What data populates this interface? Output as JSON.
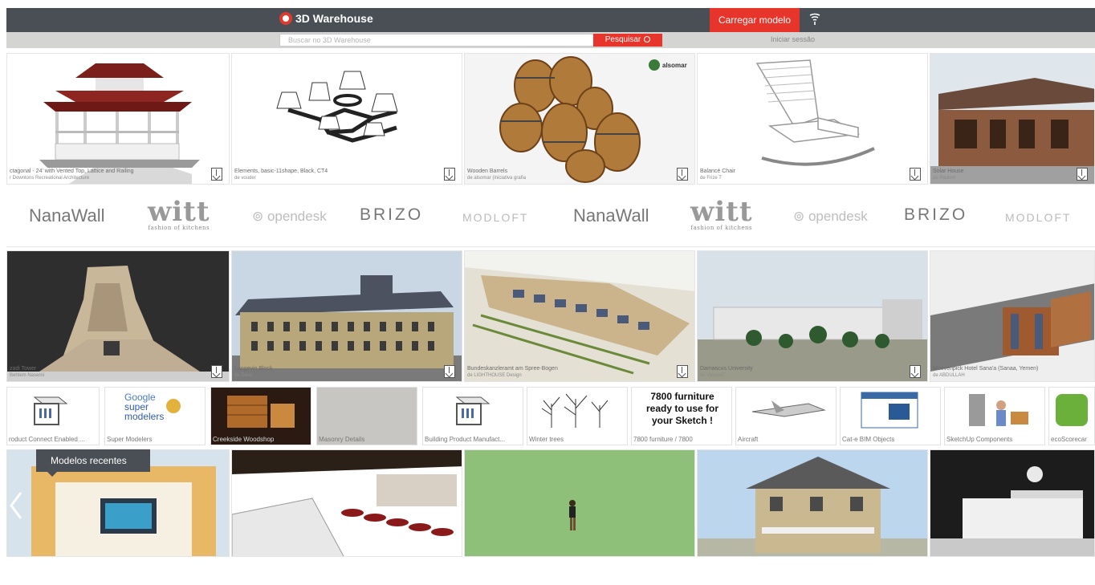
{
  "header": {
    "brand": "3D Warehouse",
    "upload_label": "Carregar modelo",
    "brand_icon": "3d-warehouse-logo-icon",
    "menu_icon": "wifi-icon"
  },
  "search": {
    "placeholder": "Buscar no 3D Warehouse",
    "button_label": "Pesquisar",
    "login_label": "Iniciar sessão"
  },
  "row1": [
    {
      "title": "ctagonal - 24' with Vented Top, Lattice and Railing",
      "author": "r Downtons Recreational Architecture"
    },
    {
      "title": "Elements, basic-11shape, Black, CT4",
      "author": "de vouder"
    },
    {
      "title": "Wooden Barrels",
      "author": "de alsomar (iniciativa grafia"
    },
    {
      "title": "Balancé Chair",
      "author": "de Frize T"
    },
    {
      "title": "Solar House",
      "author": "de Paulvel"
    }
  ],
  "row1_badge": "alsomar",
  "partners": [
    "NanaWall",
    "witt",
    "opendesk",
    "BRIZO",
    "MODLOFT",
    "NanaWall",
    "witt",
    "opendesk",
    "BRIZO",
    "MODLOFT"
  ],
  "witt_sub": "fashion of kitchens",
  "row2": [
    {
      "title": "zadi Tower",
      "author": "Behtem Naserni"
    },
    {
      "title": "Langevin Block",
      "author": "de Dave"
    },
    {
      "title": "Bundeskanzleramt am Spree-Bogen",
      "author": "de LIGHTHOUSE Design"
    },
    {
      "title": "Damascus University",
      "author": "de Venus87"
    },
    {
      "title": "Moevenpick Hotel Sana'a (Sanaa, Yemen)",
      "author": "de ABDULLAH"
    }
  ],
  "collections": [
    {
      "label": "roduct Connect Enabled ..."
    },
    {
      "label": "Super Modelers"
    },
    {
      "label": "Creekside Woodshop"
    },
    {
      "label": "Masonry Details"
    },
    {
      "label": "Building Product Manufact..."
    },
    {
      "label": "Winter trees"
    },
    {
      "label": "7800 furniture / 7800"
    },
    {
      "label": "Aircraft"
    },
    {
      "label": "Cat-e BIM Objects"
    },
    {
      "label": "SketchUp Components"
    },
    {
      "label": "ecoScorecar"
    }
  ],
  "google_label": "Google",
  "super_label": "super",
  "modelers_label": "modelers",
  "furniture_text": "7800 furniture ready to use for your Sketch !",
  "recent_label": "Modelos recentes",
  "colors": {
    "topbar": "#4a4f56",
    "accent": "#e8352b",
    "subbar": "#d4d5d2"
  }
}
